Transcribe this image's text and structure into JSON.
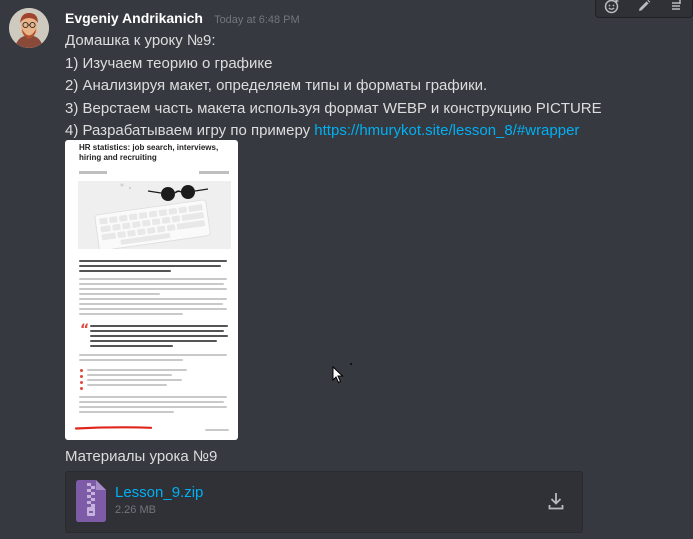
{
  "message": {
    "author": "Evgeniy Andrikanich",
    "timestamp": "Today at 6:48 PM",
    "lines": [
      "Домашка к уроку №9:",
      "1) Изучаем теорию о графике",
      "2) Анализируя макет, определяем типы и форматы графики.",
      "3) Верстаем часть макета используя формат WEBP и конструкцию PICTURE",
      "4) Разрабатываем игру по примеру "
    ],
    "link": "https://hmurykot.site/lesson_8/#wrapper"
  },
  "embed": {
    "title": "HR statistics: job search, interviews, hiring and recruiting",
    "kind": "image-preview"
  },
  "materials_label": "Материалы урока №9",
  "attachment": {
    "file_name": "Lesson_9.zip",
    "file_size": "2.26 MB",
    "icon": "zip-archive-icon"
  },
  "toolbar": {
    "icons": [
      "add-reaction-icon",
      "edit-icon",
      "more-options-icon"
    ]
  },
  "colors": {
    "background": "#36393f",
    "link": "#00b0f4",
    "author": "#ffffff",
    "timestamp": "#72767d",
    "attachment_bg": "#2f3136",
    "zip_icon": "#7e5ba7"
  }
}
